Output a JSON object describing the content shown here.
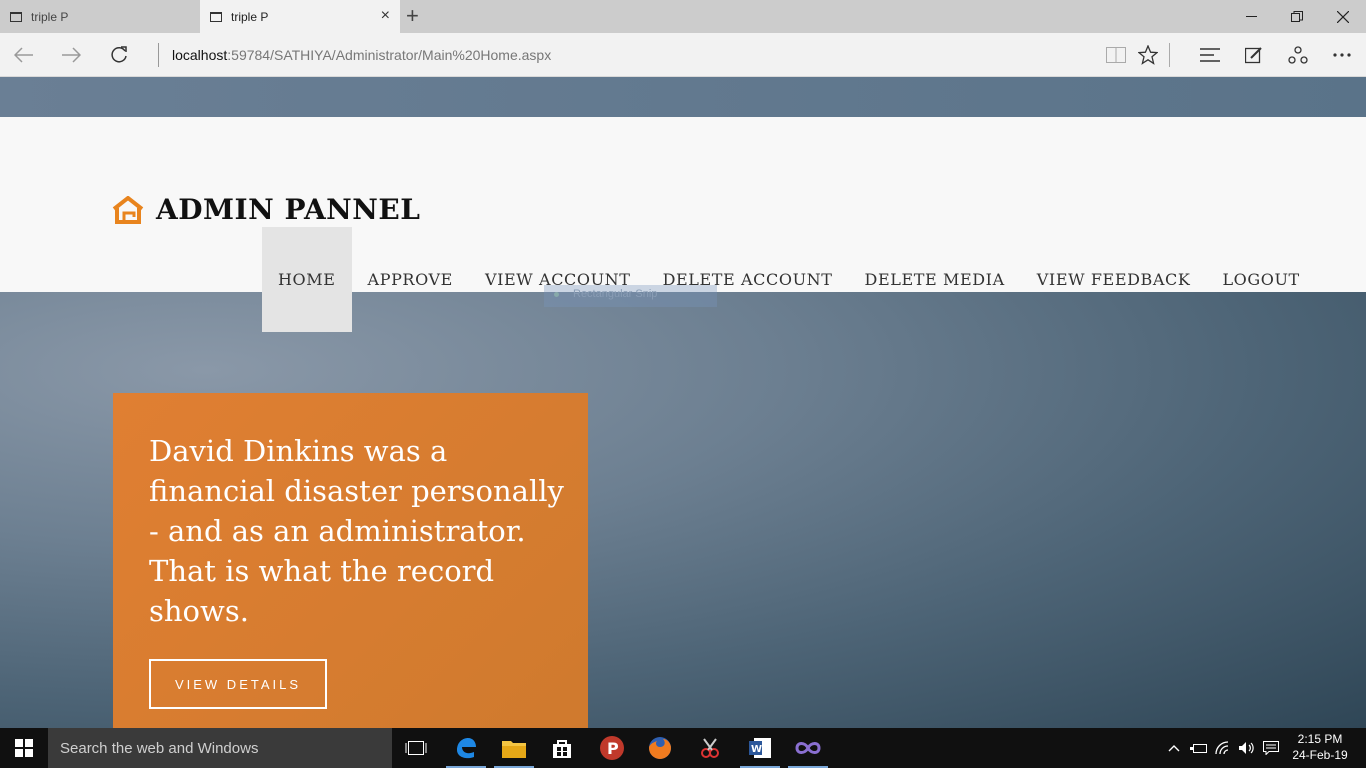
{
  "browser": {
    "tabs": [
      {
        "title": "triple P",
        "active": false
      },
      {
        "title": "triple P",
        "active": true
      }
    ],
    "close_icon": "×",
    "new_tab_icon": "+",
    "url_host": "localhost",
    "url_rest": ":59784/SATHIYA/Administrator/Main%20Home.aspx"
  },
  "header": {
    "logo_text": "ADMIN PANNEL",
    "logo_icon": "home-icon",
    "accent_color": "#e8841e"
  },
  "nav": {
    "items": [
      {
        "label": "HOME",
        "active": true
      },
      {
        "label": "APPROVE",
        "active": false
      },
      {
        "label": "VIEW ACCOUNT",
        "active": false
      },
      {
        "label": "DELETE ACCOUNT",
        "active": false
      },
      {
        "label": "DELETE MEDIA",
        "active": false
      },
      {
        "label": "VIEW FEEDBACK",
        "active": false
      },
      {
        "label": "LOGOUT",
        "active": false
      }
    ]
  },
  "overlay": {
    "snip_label": "Rectangular Snip"
  },
  "hero": {
    "quote": "David Dinkins was a financial disaster personally - and as an administrator. That is what the record shows.",
    "button_label": "VIEW DETAILS",
    "card_color": "#d97d30"
  },
  "taskbar": {
    "search_placeholder": "Search the web and Windows",
    "time": "2:15 PM",
    "date": "24-Feb-19"
  }
}
